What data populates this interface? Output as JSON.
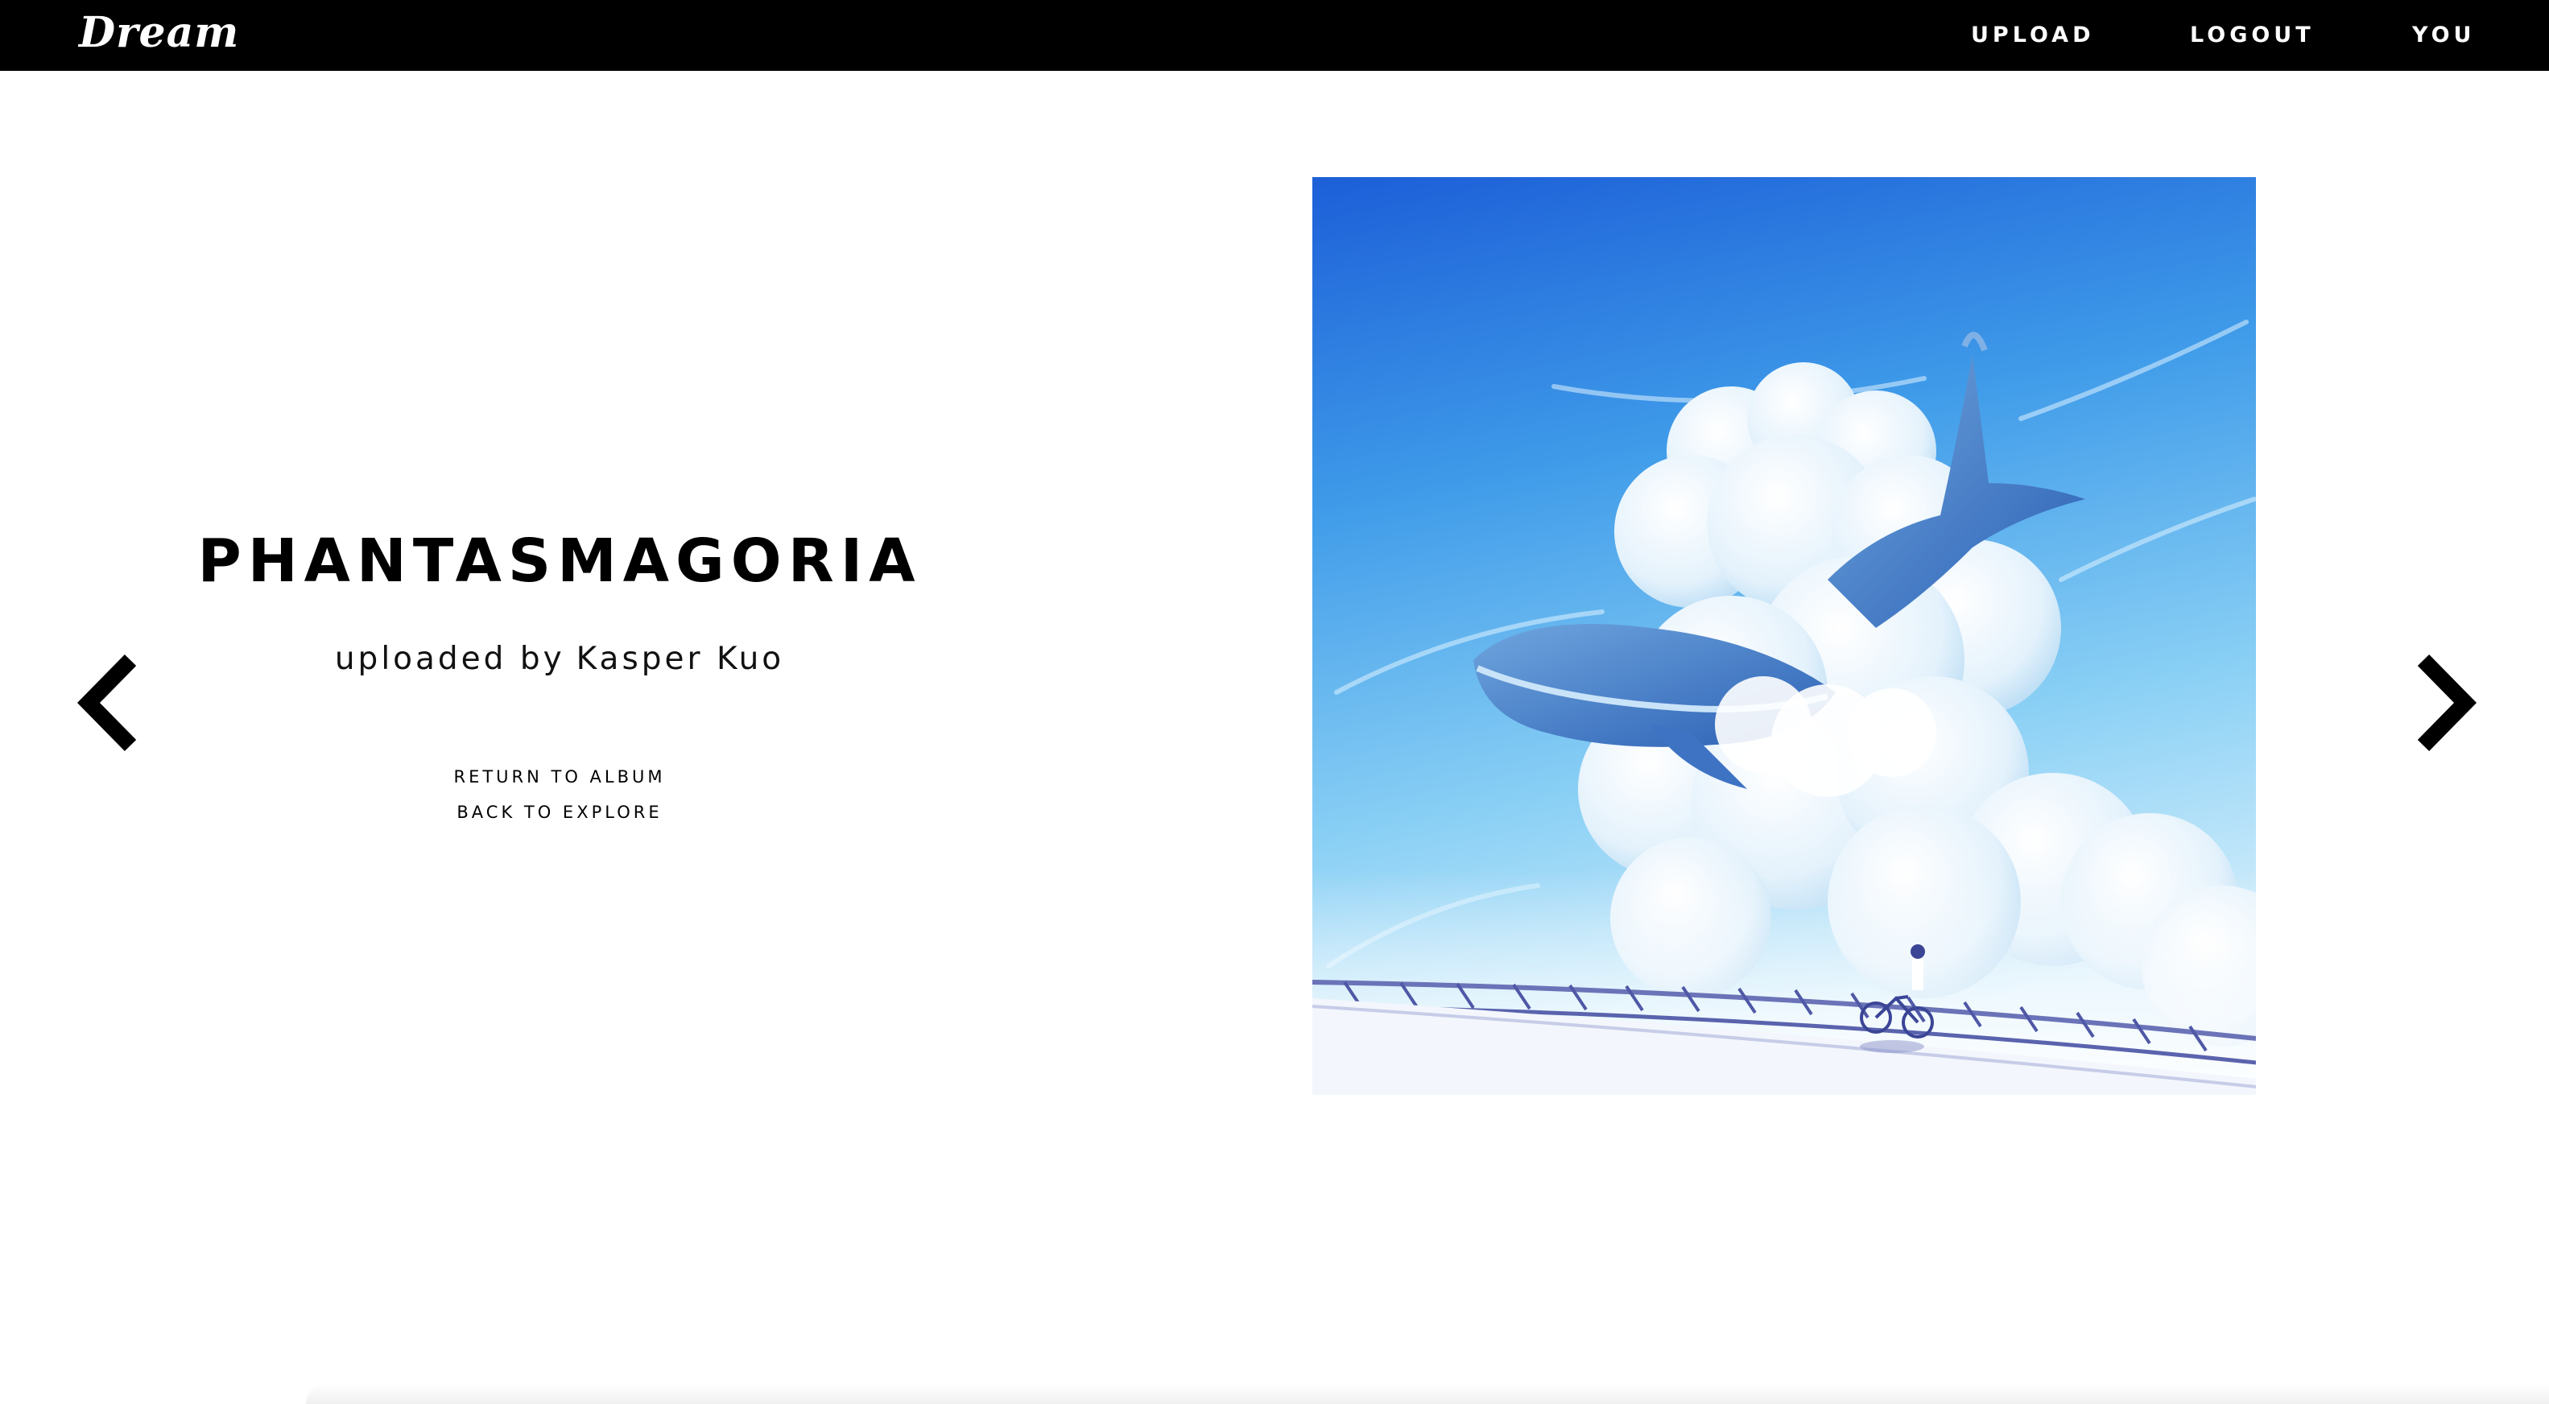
{
  "header": {
    "brand": "Dream",
    "nav": {
      "upload": "UPLOAD",
      "logout": "LOGOUT",
      "you": "YOU"
    }
  },
  "photo": {
    "title": "PHANTASMAGORIA",
    "uploaded_by_prefix": "uploaded by",
    "uploader": "Kasper Kuo",
    "return_to_album": "RETURN TO ALBUM",
    "back_to_explore": "BACK TO EXPLORE"
  },
  "icons": {
    "prev": "chevron-left-icon",
    "next": "chevron-right-icon"
  },
  "colors": {
    "topbar": "#000000",
    "background": "#ffffff",
    "sky_top": "#1f63d8",
    "sky_bottom": "#9fd8f7"
  }
}
